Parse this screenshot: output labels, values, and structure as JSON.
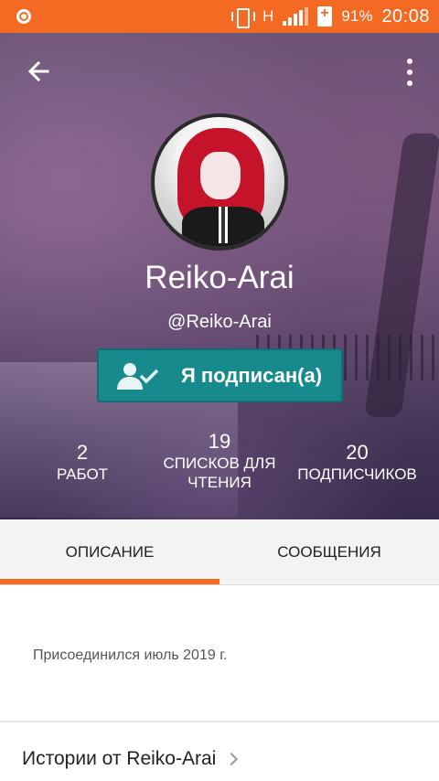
{
  "status_bar": {
    "network": "H",
    "battery": "91%",
    "time": "20:08"
  },
  "profile": {
    "display_name": "Reiko-Arai",
    "username": "@Reiko-Arai",
    "follow_label": "Я подписан(а)"
  },
  "stats": [
    {
      "value": "2",
      "label": "РАБОТ"
    },
    {
      "value": "19",
      "label": "СПИСКОВ ДЛЯ ЧТЕНИЯ"
    },
    {
      "value": "20",
      "label": "ПОДПИСЧИКОВ"
    }
  ],
  "tabs": [
    {
      "label": "ОПИСАНИЕ",
      "active": true
    },
    {
      "label": "СООБЩЕНИЯ",
      "active": false
    }
  ],
  "about": {
    "joined": "Присоединился июль 2019 г."
  },
  "stories": {
    "title": "Истории от Reiko-Arai"
  },
  "colors": {
    "accent": "#f46a22",
    "follow_button": "#168a8c"
  },
  "icons": [
    "back-arrow-icon",
    "more-vert-icon",
    "person-check-icon",
    "chevron-right-icon",
    "vibrate-icon",
    "signal-icon",
    "battery-icon"
  ]
}
